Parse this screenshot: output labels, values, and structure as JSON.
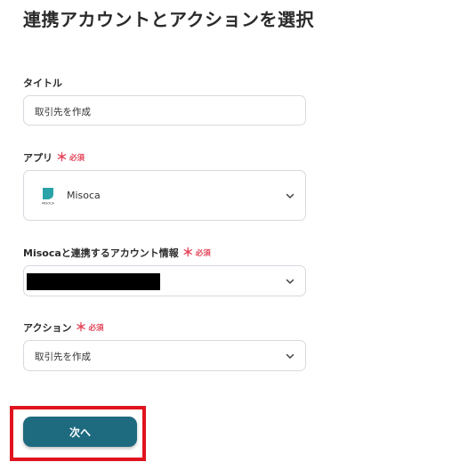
{
  "header": {
    "title": "連携アカウントとアクションを選択"
  },
  "form": {
    "title_field": {
      "label": "タイトル",
      "value": "取引先を作成"
    },
    "app_field": {
      "label": "アプリ",
      "required_mark": "＊",
      "required_text": "必須",
      "selected_app": "Misoca",
      "logo_caption": "MISOCA",
      "icon": "chevron-down-icon"
    },
    "account_field": {
      "label": "Misocaと連携するアカウント情報",
      "required_mark": "＊",
      "required_text": "必須",
      "value_redacted": true,
      "icon": "chevron-down-icon"
    },
    "action_field": {
      "label": "アクション",
      "required_mark": "＊",
      "required_text": "必須",
      "value": "取引先を作成",
      "icon": "chevron-down-icon"
    }
  },
  "footer": {
    "next_label": "次へ",
    "highlight_color": "#e0141e",
    "button_color": "#1e6b80"
  }
}
